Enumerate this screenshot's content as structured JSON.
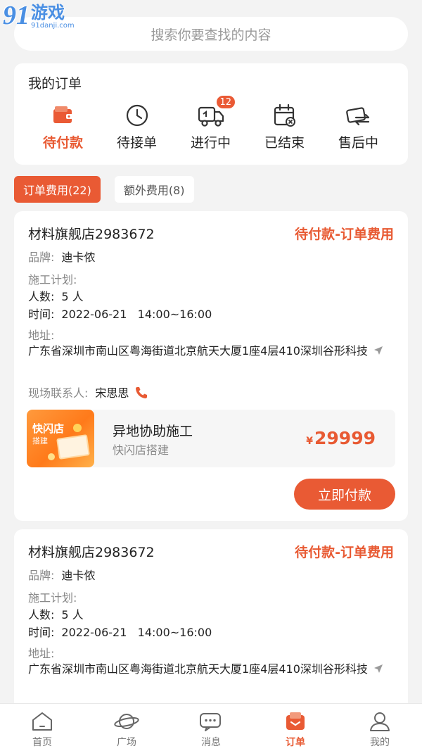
{
  "watermark": {
    "logo": "91",
    "name": "游戏",
    "url": "91danji.com"
  },
  "search": {
    "placeholder": "搜索你要查找的内容"
  },
  "my_orders": {
    "title": "我的订单",
    "statuses": [
      {
        "label": "待付款",
        "icon": "wallet-icon",
        "active": true
      },
      {
        "label": "待接单",
        "icon": "clock-icon"
      },
      {
        "label": "进行中",
        "icon": "truck-icon",
        "badge": "12"
      },
      {
        "label": "已结束",
        "icon": "calendar-x-icon"
      },
      {
        "label": "售后中",
        "icon": "exchange-icon"
      }
    ]
  },
  "tabs": [
    {
      "label": "订单费用(22)",
      "active": true
    },
    {
      "label": "额外费用(8)"
    }
  ],
  "orders": [
    {
      "shop": "材料旗舰店2983672",
      "status": "待付款-订单费用",
      "brand_label": "品牌:",
      "brand": "迪卡侬",
      "plan_label": "施工计划:",
      "people_label": "人数:",
      "people": "5 人",
      "time_label": "时间:",
      "time": "2022-06-21   14:00~16:00",
      "address_label": "地址:",
      "address": "广东省深圳市南山区粤海街道北京航天大厦1座4层410深圳谷形科技",
      "contact_label": "现场联系人:",
      "contact": "宋思思",
      "service": {
        "thumb_title": "快闪店",
        "thumb_sub": "搭建",
        "title": "异地协助施工",
        "subtitle": "快闪店搭建",
        "currency": "¥",
        "price": "29999"
      },
      "pay_button": "立即付款"
    },
    {
      "shop": "材料旗舰店2983672",
      "status": "待付款-订单费用",
      "brand_label": "品牌:",
      "brand": "迪卡侬",
      "plan_label": "施工计划:",
      "people_label": "人数:",
      "people": "5 人",
      "time_label": "时间:",
      "time": "2022-06-21   14:00~16:00",
      "address_label": "地址:",
      "address": "广东省深圳市南山区粤海街道北京航天大厦1座4层410深圳谷形科技"
    }
  ],
  "bottom_nav": [
    {
      "label": "首页",
      "icon": "home-icon"
    },
    {
      "label": "广场",
      "icon": "planet-icon"
    },
    {
      "label": "消息",
      "icon": "chat-icon"
    },
    {
      "label": "订单",
      "icon": "order-icon",
      "active": true
    },
    {
      "label": "我的",
      "icon": "user-icon"
    }
  ],
  "colors": {
    "accent": "#e95a34",
    "background": "#f3f3f3"
  }
}
